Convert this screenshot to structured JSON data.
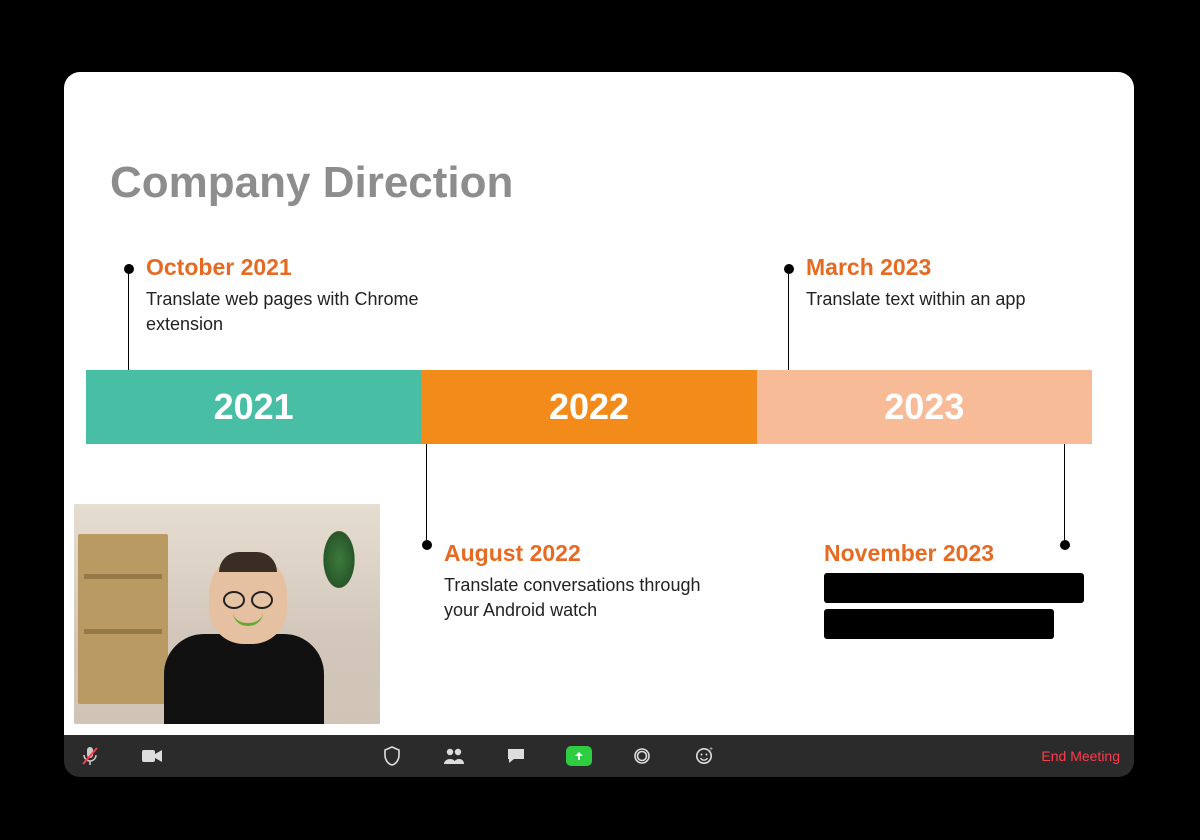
{
  "slide": {
    "title": "Company Direction",
    "timeline": {
      "segments": [
        {
          "year": "2021",
          "color": "#48bfa4"
        },
        {
          "year": "2022",
          "color": "#f28b19"
        },
        {
          "year": "2023",
          "color": "#f8bb98"
        }
      ]
    },
    "milestones": [
      {
        "title": "October 2021",
        "description": "Translate web pages with Chrome extension"
      },
      {
        "title": "March 2023",
        "description": "Translate text within an app"
      },
      {
        "title": "August 2022",
        "description": "Translate conversations through your Android watch"
      },
      {
        "title": "November 2023",
        "description_redacted": true
      }
    ]
  },
  "presenter": {
    "label": "Presenter webcam"
  },
  "toolbar": {
    "icons": {
      "mic": "microphone-muted-icon",
      "video": "video-camera-icon",
      "security": "shield-icon",
      "participants": "participants-icon",
      "chat": "chat-icon",
      "share": "share-screen-icon",
      "record": "record-icon",
      "reactions": "reactions-icon"
    },
    "end_label": "End Meeting"
  }
}
